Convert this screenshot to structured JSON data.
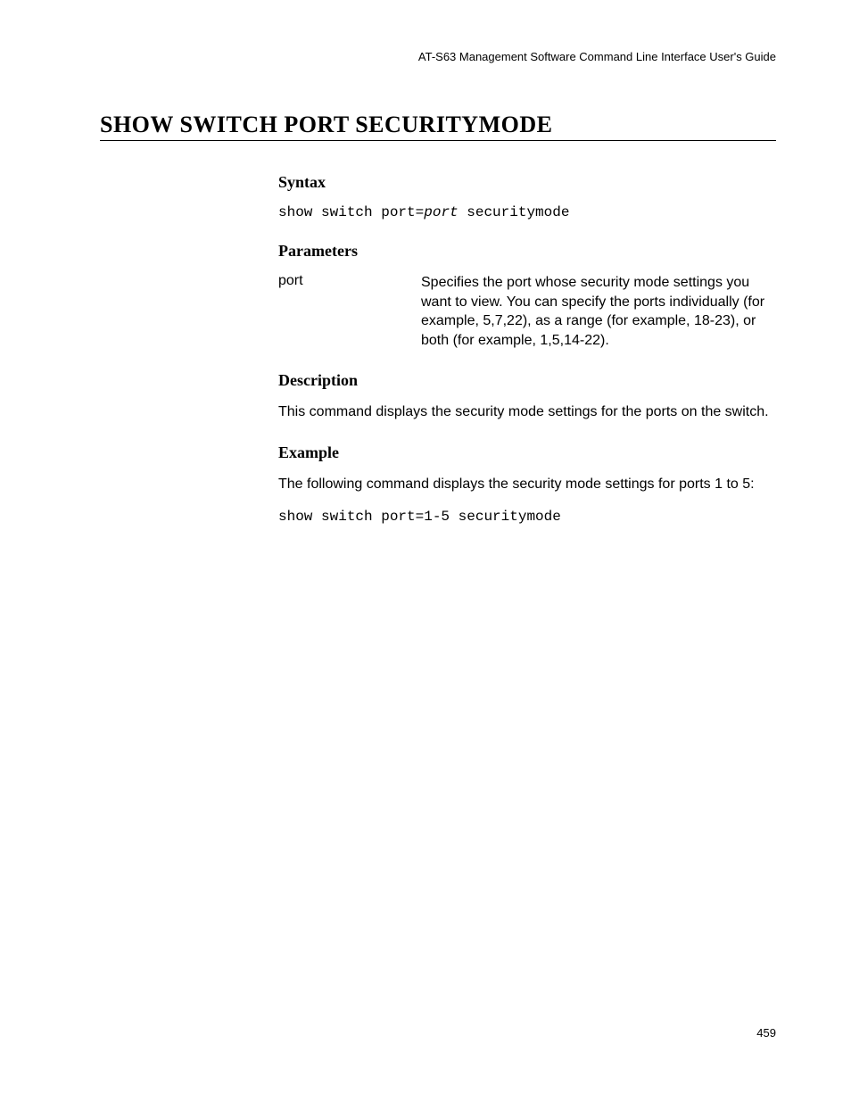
{
  "header": {
    "running_title": "AT-S63 Management Software Command Line Interface User's Guide"
  },
  "title": "SHOW SWITCH PORT SECURITYMODE",
  "sections": {
    "syntax": {
      "heading": "Syntax",
      "prefix": "show switch port=",
      "italic": "port",
      "suffix": " securitymode"
    },
    "parameters": {
      "heading": "Parameters",
      "items": [
        {
          "name": "port",
          "description": "Specifies the port whose security mode settings you want to view. You can specify the ports individually (for example, 5,7,22), as a range (for example, 18-23), or both (for example, 1,5,14-22)."
        }
      ]
    },
    "description": {
      "heading": "Description",
      "text": "This command displays the security mode settings for the ports on the switch."
    },
    "example": {
      "heading": "Example",
      "intro": "The following command displays the security mode settings for ports 1 to 5:",
      "code": "show switch port=1-5 securitymode"
    }
  },
  "page_number": "459"
}
